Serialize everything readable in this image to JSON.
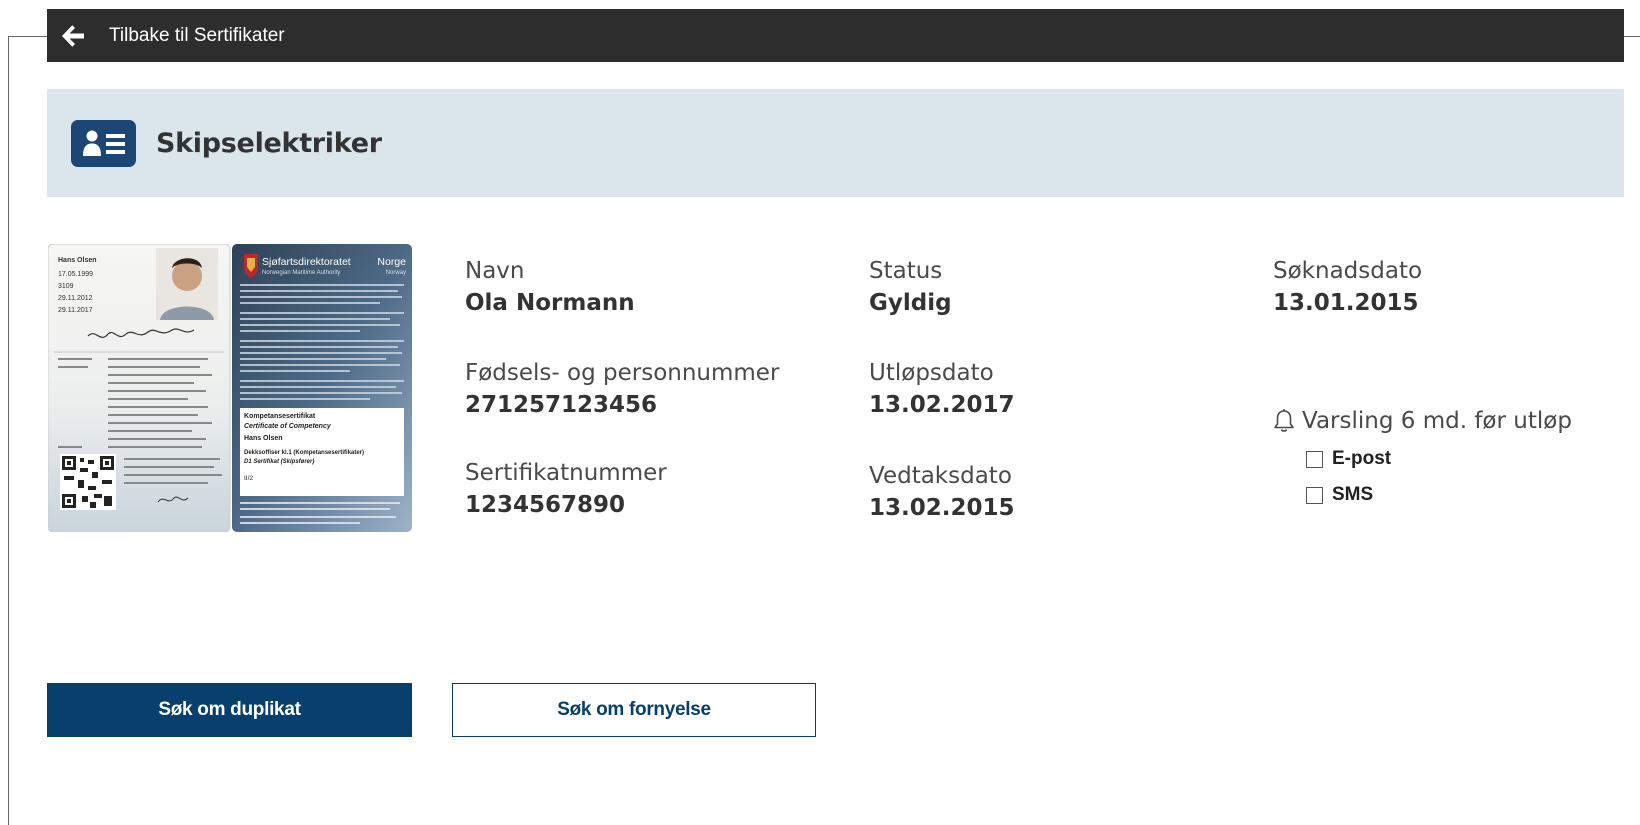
{
  "nav": {
    "back_label": "Tilbake til Sertifikater"
  },
  "header": {
    "title": "Skipselektriker",
    "icon": "id-card-icon"
  },
  "card": {
    "front": {
      "name": "Hans Olsen",
      "dates": [
        "17.05.1999",
        "3109",
        "29.11.2012",
        "29.11.2017"
      ]
    },
    "back": {
      "authority": "Sjøfartsdirektoratet",
      "authority_en": "Norwegian Maritime Authority",
      "country": "Norge",
      "country_en": "Norway",
      "cert_title": "Kompetansesertifikat",
      "cert_title_en": "Certificate of Competency",
      "holder": "Hans Olsen",
      "line1": "Dekksoffiser kl.1 (Kompetansesertifikater)",
      "line2": "D1 Sertifikat (Skipsfører)",
      "line3": "II/2"
    }
  },
  "fields": {
    "name_label": "Navn",
    "name_value": "Ola Normann",
    "personal_id_label": "Fødsels- og personnummer",
    "personal_id_value": "271257123456",
    "cert_number_label": "Sertifikatnummer",
    "cert_number_value": "1234567890",
    "status_label": "Status",
    "status_value": "Gyldig",
    "expiry_label": "Utløpsdato",
    "expiry_value": "13.02.2017",
    "decision_label": "Vedtaksdato",
    "decision_value": "13.02.2015",
    "application_label": "Søknadsdato",
    "application_value": "13.01.2015"
  },
  "notification": {
    "title": "Varsling 6 md. før utløp",
    "options": [
      {
        "label": "E-post",
        "checked": false
      },
      {
        "label": "SMS",
        "checked": false
      }
    ]
  },
  "actions": {
    "duplicate_label": "Søk om duplikat",
    "renewal_label": "Søk om fornyelse"
  },
  "colors": {
    "topbar": "#2d2d2d",
    "header_band": "#dbe5ec",
    "primary": "#07406e",
    "icon_bg": "#1c4774"
  }
}
